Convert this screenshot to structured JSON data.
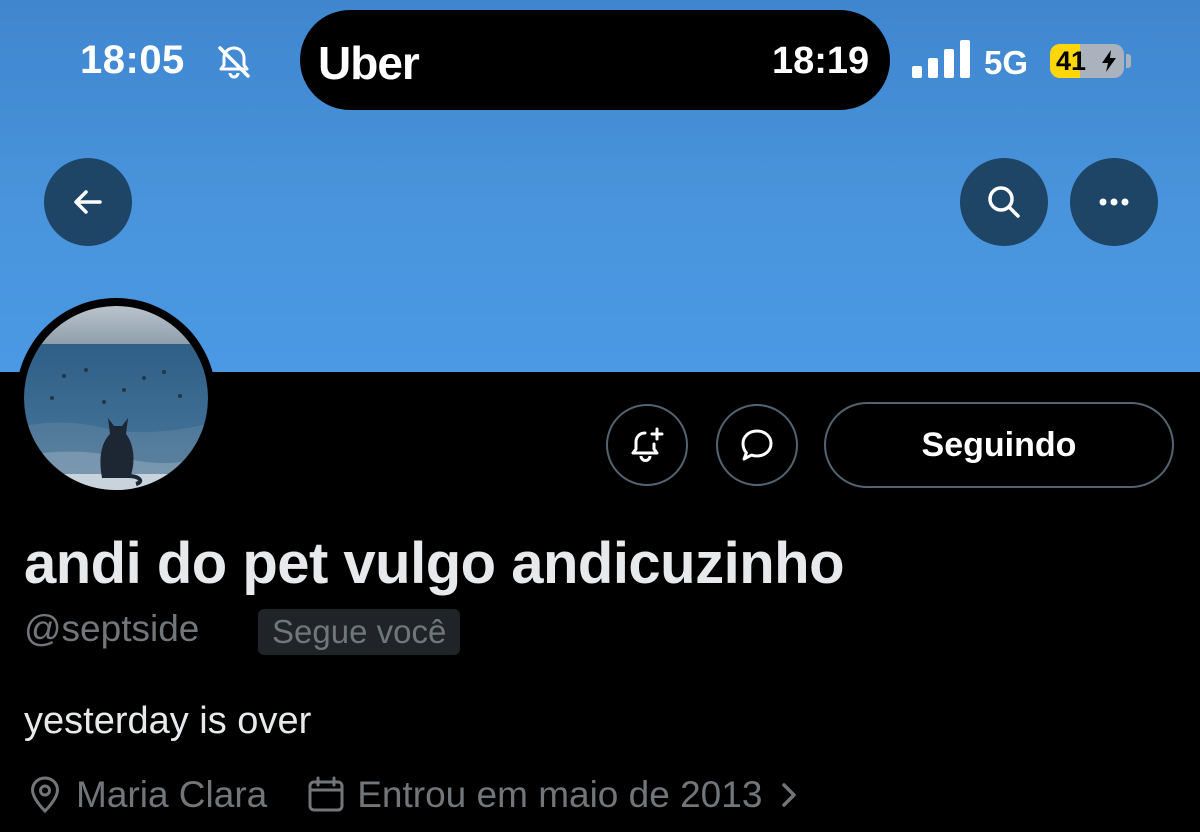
{
  "status_bar": {
    "time": "18:05",
    "live_activity_app": "Uber",
    "live_activity_time": "18:19",
    "network": "5G",
    "battery_level": "41",
    "battery_fraction": 0.41
  },
  "header": {
    "back_icon": "arrow-left-icon",
    "search_icon": "search-icon",
    "more_icon": "ellipsis-icon"
  },
  "profile": {
    "display_name": "andi do pet vulgo andicuzinho",
    "handle": "@septside",
    "follows_you_label": "Segue você",
    "bio": "yesterday is over",
    "location": "Maria Clara",
    "joined": "Entrou em maio de 2013"
  },
  "actions": {
    "following_label": "Seguindo",
    "notify_icon": "bell-plus-icon",
    "message_icon": "chat-bubble-icon"
  },
  "colors": {
    "banner": "#4a95de",
    "header_button": "#1e4466",
    "muted_text": "#71767b",
    "battery": "#ffd60a"
  }
}
